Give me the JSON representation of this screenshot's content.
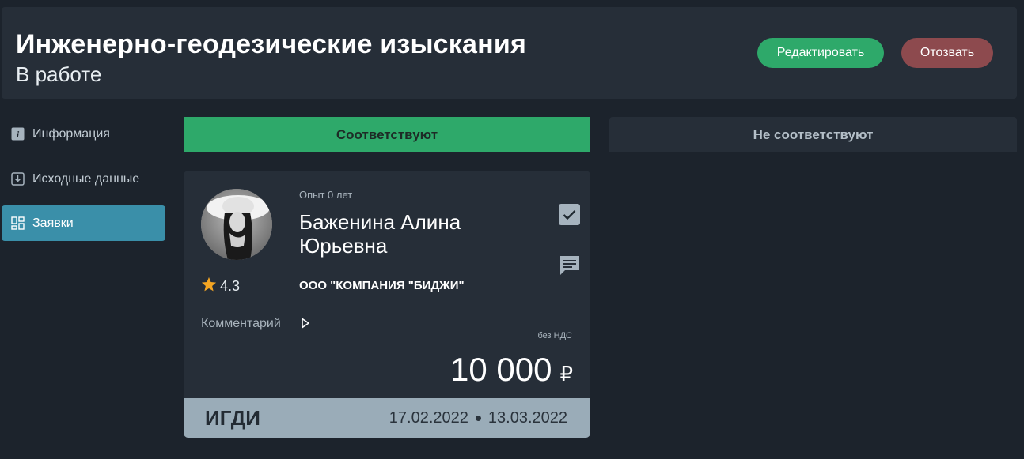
{
  "header": {
    "title": "Инженерно-геодезические изыскания",
    "status": "В работе",
    "edit_label": "Редактировать",
    "withdraw_label": "Отозвать"
  },
  "sidebar": {
    "items": [
      {
        "label": "Информация",
        "icon": "info-icon",
        "active": false
      },
      {
        "label": "Исходные данные",
        "icon": "download-icon",
        "active": false
      },
      {
        "label": "Заявки",
        "icon": "grid-icon",
        "active": true
      }
    ]
  },
  "tabs": {
    "match_label": "Соответствуют",
    "nomatch_label": "Не соответствуют"
  },
  "bid": {
    "experience": "Опыт 0 лет",
    "name": "Баженина Алина Юрьевна",
    "rating": "4.3",
    "company": "ООО \"КОМПАНИЯ \"БИДЖИ\"",
    "comment_label": "Комментарий",
    "vat_note": "без НДС",
    "price": "10 000",
    "currency": "₽",
    "code": "ИГДИ",
    "date_start": "17.02.2022",
    "date_end": "13.03.2022"
  },
  "colors": {
    "background": "#1c232c",
    "panel": "#262e38",
    "accent_green": "#2ea96a",
    "withdraw_red": "#8d4a4e",
    "active_blue": "#3a8fa9",
    "star": "#f5a623",
    "footer": "#9aacb8"
  }
}
